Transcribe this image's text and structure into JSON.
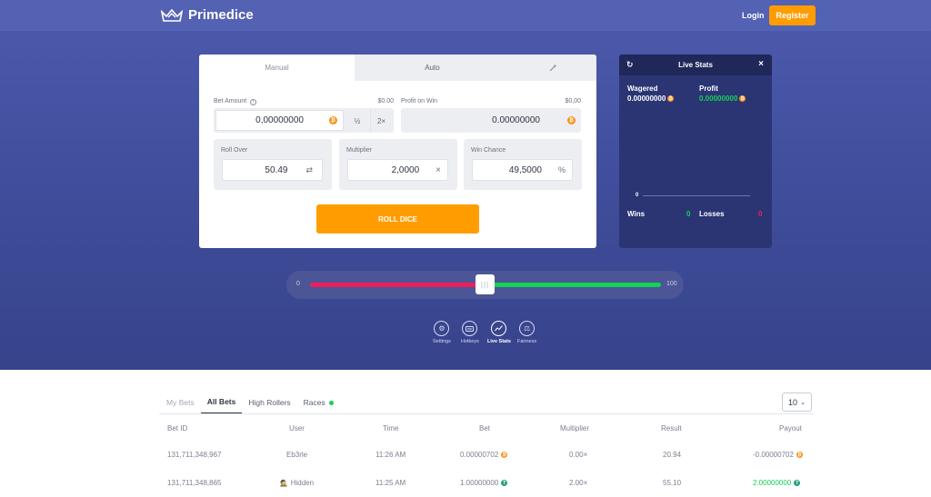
{
  "brand": {
    "name": "Primedice"
  },
  "nav": {
    "login": "Login",
    "register": "Register"
  },
  "bet_tabs": {
    "manual": "Manual",
    "auto": "Auto",
    "shortcut_icon": "magic-wand-icon"
  },
  "bet": {
    "amount_label": "Bet Amount",
    "amount_fiat": "$0.00",
    "amount_value": "0,00000000",
    "half": "½",
    "double": "2×",
    "profit_label": "Profit on Win",
    "profit_fiat": "$0,00",
    "profit_value": "0.00000000"
  },
  "roll": {
    "roll_over_label": "Roll Over",
    "roll_over_value": "50.49",
    "multiplier_label": "Multiplier",
    "multiplier_value": "2,0000",
    "multiplier_suffix": "×",
    "win_chance_label": "Win Chance",
    "win_chance_value": "49,5000",
    "win_chance_suffix": "%",
    "button": "ROLL DICE"
  },
  "live_stats": {
    "title": "Live Stats",
    "wagered_label": "Wagered",
    "wagered_value": "0.00000000",
    "profit_label": "Profit",
    "profit_value": "0.00000000",
    "graph_zero": "0",
    "wins_label": "Wins",
    "wins_value": "0",
    "losses_label": "Losses",
    "losses_value": "0"
  },
  "slider": {
    "min": "0",
    "max": "100",
    "handle": "|||",
    "roll_over_fraction": 0.5049
  },
  "tools": [
    {
      "label": "Settings",
      "icon": "gear-icon"
    },
    {
      "label": "Hotkeys",
      "icon": "keyboard-icon"
    },
    {
      "label": "Live Stats",
      "icon": "chart-icon"
    },
    {
      "label": "Fairness",
      "icon": "scale-icon"
    }
  ],
  "bets_tabs": {
    "my_bets": "My Bets",
    "all_bets": "All Bets",
    "high_rollers": "High Rollers",
    "races": "Races"
  },
  "page_size": "10",
  "table": {
    "headers": [
      "Bet ID",
      "User",
      "Time",
      "Bet",
      "Multiplier",
      "Result",
      "Payout"
    ],
    "rows": [
      {
        "id": "131,711,348,967",
        "user": "Eb3rle",
        "time": "11:26 AM",
        "bet": "0.00000702",
        "multiplier": "0.00×",
        "result": "20.94",
        "payout": "-0.00000702"
      },
      {
        "id": "131,711,348,865",
        "user": "Hidden",
        "time": "11:25 AM",
        "bet": "1.00000000",
        "multiplier": "2.00×",
        "result": "55.10",
        "payout": "2.00000000"
      }
    ]
  },
  "colors": {
    "accent": "#ff9d00",
    "win": "#15d156",
    "loss": "#ed1f5d",
    "bg": "#41509f"
  }
}
